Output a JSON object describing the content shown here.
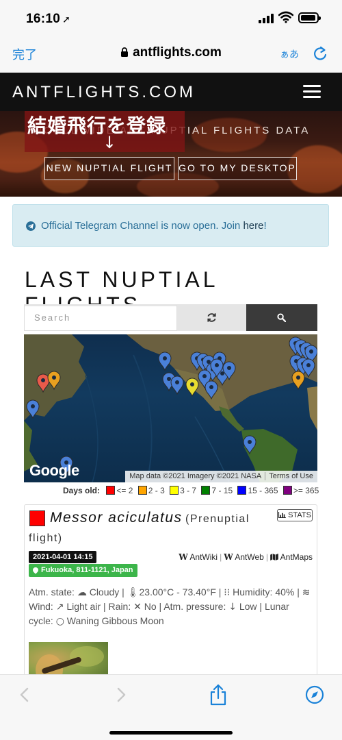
{
  "status_bar": {
    "time": "16:10",
    "location_glyph": "➚"
  },
  "browser": {
    "done_label": "完了",
    "url": "antflights.com",
    "text_size_label": "ぁあ"
  },
  "site_header": {
    "brand": "ANTFLIGHTS.COM"
  },
  "hero": {
    "tagline": "WORLDWIDE ANT NUPTIAL FLIGHTS DATA",
    "overlay_text": "結婚飛行を登録",
    "overlay_arrow": "↓",
    "buttons": {
      "new_flight": "NEW NUPTIAL FLIGHT",
      "desktop": "GO TO MY DESKTOP"
    }
  },
  "alert": {
    "text": "Official Telegram Channel is now open. Join ",
    "link": "here",
    "suffix": "!"
  },
  "heading": "LAST NUPTIAL FLIGHTS",
  "search": {
    "placeholder": "Search"
  },
  "map": {
    "logo": "Google",
    "credits": "Map data ©2021 Imagery ©2021 NASA",
    "terms": "Terms of Use"
  },
  "legend": {
    "title": "Days old:",
    "items": [
      {
        "label": "<= 2",
        "color": "#ff0000"
      },
      {
        "label": "2 - 3",
        "color": "#ffa500"
      },
      {
        "label": "3 - 7",
        "color": "#ffff00"
      },
      {
        "label": "7 - 15",
        "color": "#008000"
      },
      {
        "label": "15 - 365",
        "color": "#0000ff"
      },
      {
        "label": ">= 365",
        "color": "#800080"
      }
    ]
  },
  "flight": {
    "species": "Messor aciculatus",
    "type_line1": "(Prenuptial",
    "type_line2": "flight)",
    "stats_label": "STATS",
    "datetime": "2021-04-01 14:15",
    "location": "Fukuoka, 811-1121, Japan",
    "links": [
      "AntWiki",
      "AntWeb",
      "AntMaps"
    ],
    "atm_state_label": "Atm. state:",
    "atm_state": "Cloudy",
    "temperature": "23.00°C - 73.40°F",
    "humidity_label": "Humidity:",
    "humidity": "40%",
    "wind_label": "Wind:",
    "wind": "Light air",
    "rain_label": "Rain:",
    "rain": "No",
    "pressure_label": "Atm. pressure:",
    "pressure": "Low",
    "lunar_label": "Lunar cycle:",
    "lunar": "Waning Gibbous Moon"
  },
  "colors": {
    "accent_blue": "#1a82d8",
    "alert_text": "#2a6f98",
    "badge_green": "#3cb54a"
  }
}
